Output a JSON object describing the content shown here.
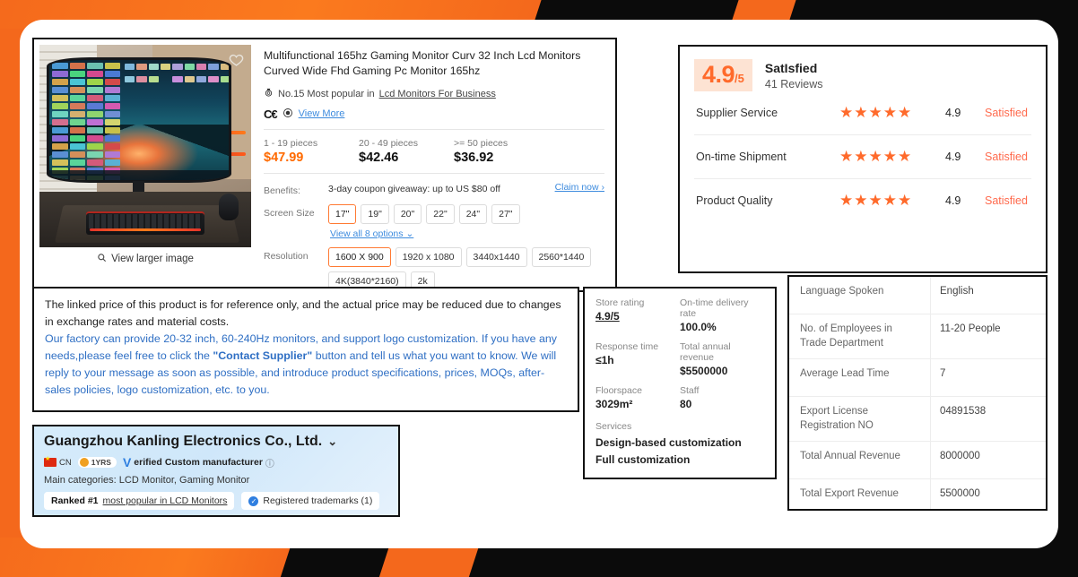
{
  "theme": {
    "orange": "#f4681c",
    "accent_price": "#ff6a00",
    "link_blue": "#3d8bde",
    "tag_orange": "#ff6a4d"
  },
  "product": {
    "title": "Multifunctional 165hz Gaming Monitor Curv 32 Inch Lcd Monitors Curved Wide Fhd Gaming Pc Monitor 165hz",
    "rank_prefix": "No.15 Most popular in",
    "rank_link": "Lcd Monitors For Business",
    "cert_view_more": "View More",
    "view_larger_image": "View larger image",
    "price_tiers": [
      {
        "qty": "1 - 19 pieces",
        "price": "$47.99"
      },
      {
        "qty": "20 - 49 pieces",
        "price": "$42.46"
      },
      {
        "qty": ">= 50 pieces",
        "price": "$36.92"
      }
    ],
    "benefits_label": "Benefits:",
    "benefits_text": "3-day coupon giveaway: up to US $80 off",
    "claim_now": "Claim now",
    "screen_size_label": "Screen Size",
    "screen_sizes": [
      "17\"",
      "19\"",
      "20\"",
      "22\"",
      "24\"",
      "27\""
    ],
    "screen_size_selected": "17\"",
    "view_all_options": "View all 8 options",
    "resolution_label": "Resolution",
    "resolutions": [
      "1600 X 900",
      "1920 x 1080",
      "3440x1440",
      "2560*1440",
      "4K(3840*2160)",
      "2k"
    ],
    "resolution_selected": "1600 X 900"
  },
  "reviews": {
    "score": "4.9",
    "score_denominator": "/5",
    "title": "SatIsfied",
    "count": "41 Reviews",
    "stars": "★★★★★",
    "rows": [
      {
        "name": "Supplier Service",
        "score": "4.9",
        "tag": "Satisfied"
      },
      {
        "name": "On-time Shipment",
        "score": "4.9",
        "tag": "Satisfied"
      },
      {
        "name": "Product Quality",
        "score": "4.9",
        "tag": "Satisfied"
      }
    ]
  },
  "note": {
    "black_text": "The linked price of this product is for reference only, and the actual price may be reduced due to changes in exchange rates and material costs.",
    "blue_part1": "Our factory can provide 20-32 inch, 60-240Hz monitors, and support logo customization. If you have any needs,please feel free to click the ",
    "blue_bold": "\"Contact Supplier\"",
    "blue_part2": " button and tell us what you want to know. We will reply to your message as soon as possible, and introduce product specifications, prices, MOQs, after-sales policies, logo customization, etc. to you."
  },
  "store": {
    "store_rating_label": "Store rating",
    "store_rating_value": "4.9/5",
    "delivery_label": "On-time delivery rate",
    "delivery_value": "100.0%",
    "response_label": "Response time",
    "response_value": "≤1h",
    "revenue_label": "Total annual revenue",
    "revenue_value": "$5500000",
    "floorspace_label": "Floorspace",
    "floorspace_value": "3029m²",
    "staff_label": "Staff",
    "staff_value": "80",
    "services_label": "Services",
    "services": [
      "Design-based customization",
      "Full customization"
    ]
  },
  "company_table": {
    "rows": [
      {
        "key": "Language Spoken",
        "value": "English"
      },
      {
        "key": "No. of Employees in Trade Department",
        "value": "11-20 People"
      },
      {
        "key": "Average Lead Time",
        "value": "7"
      },
      {
        "key": "Export License Registration NO",
        "value": "04891538"
      },
      {
        "key": "Total Annual Revenue",
        "value": "8000000"
      },
      {
        "key": "Total Export Revenue",
        "value": "5500000"
      }
    ]
  },
  "supplier": {
    "name": "Guangzhou Kanling Electronics Co., Ltd.",
    "country_code": "CN",
    "years": "1YRS",
    "verified_v": "V",
    "verified_rest": "erified",
    "manufacturer_type": "Custom manufacturer",
    "categories": "Main categories: LCD Monitor, Gaming Monitor",
    "ranked_prefix": "Ranked #1",
    "ranked_link": "most popular in LCD Monitors",
    "trademarks": "Registered trademarks (1)"
  }
}
